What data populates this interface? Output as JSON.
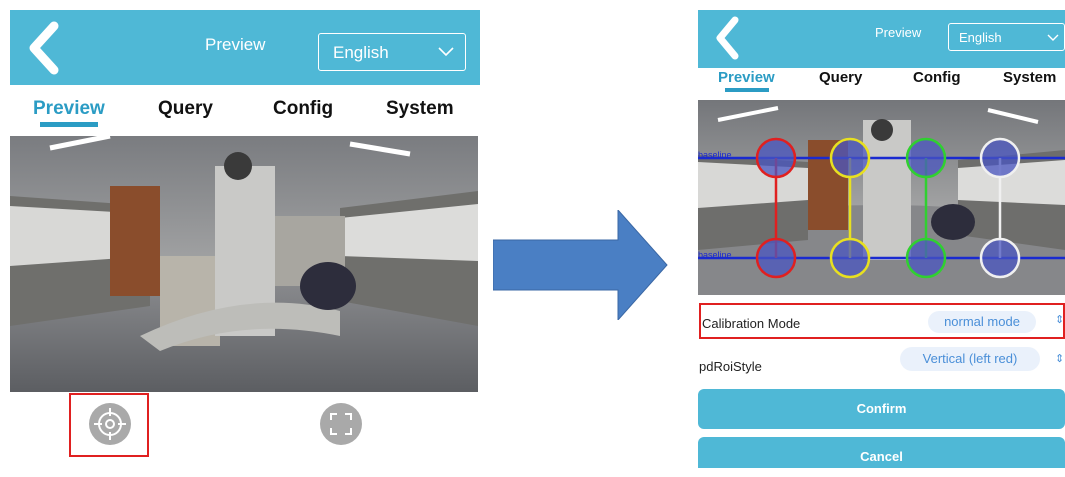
{
  "left_phone": {
    "header": {
      "back_icon": "chevron-left-icon",
      "title": "Preview",
      "language": "English"
    },
    "tabs": [
      {
        "label": "Preview",
        "active": true
      },
      {
        "label": "Query",
        "active": false
      },
      {
        "label": "Config",
        "active": false
      },
      {
        "label": "System",
        "active": false
      }
    ],
    "controls": {
      "calibrate_icon": "crosshair-icon",
      "fullscreen_icon": "fullscreen-icon"
    }
  },
  "arrow": {
    "icon": "right-arrow-icon",
    "color": "#4a7fc4"
  },
  "right_phone": {
    "header": {
      "back_icon": "chevron-left-icon",
      "title": "Preview",
      "language": "English"
    },
    "tabs": [
      {
        "label": "Preview",
        "active": true
      },
      {
        "label": "Query",
        "active": false
      },
      {
        "label": "Config",
        "active": false
      },
      {
        "label": "System",
        "active": false
      }
    ],
    "overlay_labels": {
      "top": "baseline",
      "bottom": "baseline"
    },
    "settings": [
      {
        "label": "Calibration Mode",
        "value": "normal mode"
      },
      {
        "label": "pdRoiStyle",
        "value": "Vertical (left red)"
      }
    ],
    "buttons": {
      "confirm": "Confirm",
      "cancel": "Cancel"
    }
  },
  "colors": {
    "header": "#4fb8d6",
    "tab_active": "#2b9cc4",
    "highlight_box": "#e02020",
    "roi_red": "#e02020",
    "roi_yellow": "#e8e020",
    "roi_green": "#30d030",
    "roi_white": "#f0f0f0",
    "baseline": "#1a2ad0"
  }
}
